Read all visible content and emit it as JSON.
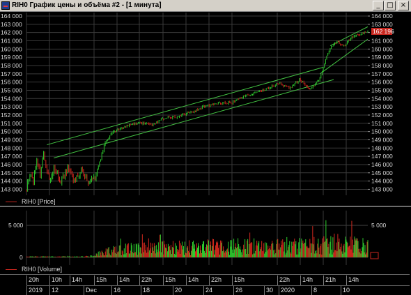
{
  "window": {
    "title": "RIH0 График цены и объёма #2 - [1 минута]",
    "buttons": {
      "minimize": "_",
      "maximize": "□",
      "close": "×"
    }
  },
  "price_panel": {
    "legend": "RIH0 [Price]",
    "y_ticks": [
      "164 000",
      "163 000",
      "162 000",
      "161 000",
      "160 000",
      "159 000",
      "158 000",
      "157 000",
      "156 000",
      "155 000",
      "154 000",
      "153 000",
      "152 000",
      "151 000",
      "150 000",
      "149 000",
      "148 000",
      "147 000",
      "146 000",
      "145 000",
      "144 000",
      "143 000"
    ],
    "last_price_label": "162 196",
    "colors": {
      "up": "#2ecc2e",
      "down": "#d2281e",
      "channel": "#43c243",
      "last_price_box": "#c8261e"
    }
  },
  "volume_panel": {
    "legend": "RIH0 [Volume]",
    "y_ticks": [
      "5 000",
      "0"
    ],
    "colors": {
      "up": "#2ecc2e",
      "down": "#d2281e"
    }
  },
  "time_axis": {
    "hours": [
      "20h",
      "10h",
      "14h",
      "15h",
      "14h",
      "22h",
      "15h",
      "14h",
      "22h",
      "15h",
      "22h",
      "14h",
      "21h",
      "14h"
    ],
    "dates": [
      "2019",
      "12",
      "Dec",
      "16",
      "18",
      "20",
      "24",
      "26",
      "30",
      "2020",
      "8",
      "10"
    ]
  },
  "chart_data": [
    {
      "type": "candlestick",
      "title": "RIH0 График цены и объёма #2 - [1 минута]",
      "series": [
        {
          "name": "RIH0 [Price]"
        }
      ],
      "ylim": [
        142700,
        164000
      ],
      "y_ticks": [
        164000,
        163000,
        162000,
        161000,
        160000,
        159000,
        158000,
        157000,
        156000,
        155000,
        154000,
        153000,
        152000,
        151000,
        150000,
        149000,
        148000,
        147000,
        146000,
        145000,
        144000,
        143000
      ],
      "x_tick_labels": [
        "20h",
        "10h",
        "14h",
        "15h",
        "14h",
        "22h",
        "15h",
        "14h",
        "22h",
        "15h",
        "22h",
        "14h",
        "21h",
        "14h"
      ],
      "x_date_labels": [
        "2019",
        "12",
        "Dec",
        "16",
        "18",
        "20",
        "24",
        "26",
        "30",
        "2020",
        "8",
        "10"
      ],
      "price_path": [
        [
          0,
          142900
        ],
        [
          0.01,
          144800
        ],
        [
          0.02,
          143600
        ],
        [
          0.03,
          146800
        ],
        [
          0.04,
          144500
        ],
        [
          0.05,
          147300
        ],
        [
          0.06,
          145200
        ],
        [
          0.07,
          144000
        ],
        [
          0.08,
          145800
        ],
        [
          0.1,
          143800
        ],
        [
          0.12,
          145600
        ],
        [
          0.14,
          144200
        ],
        [
          0.16,
          145300
        ],
        [
          0.18,
          143700
        ],
        [
          0.2,
          144300
        ],
        [
          0.215,
          146400
        ],
        [
          0.23,
          148600
        ],
        [
          0.25,
          149900
        ],
        [
          0.28,
          150500
        ],
        [
          0.31,
          150900
        ],
        [
          0.34,
          151000
        ],
        [
          0.37,
          150800
        ],
        [
          0.4,
          151600
        ],
        [
          0.44,
          151800
        ],
        [
          0.48,
          152300
        ],
        [
          0.52,
          153000
        ],
        [
          0.56,
          153400
        ],
        [
          0.6,
          153500
        ],
        [
          0.64,
          154300
        ],
        [
          0.68,
          154800
        ],
        [
          0.71,
          155300
        ],
        [
          0.74,
          155900
        ],
        [
          0.77,
          155200
        ],
        [
          0.8,
          156300
        ],
        [
          0.83,
          155100
        ],
        [
          0.86,
          156400
        ],
        [
          0.87,
          157800
        ],
        [
          0.88,
          159200
        ],
        [
          0.89,
          160200
        ],
        [
          0.91,
          160900
        ],
        [
          0.93,
          160400
        ],
        [
          0.95,
          161300
        ],
        [
          0.97,
          161700
        ],
        [
          1.0,
          162196
        ]
      ],
      "channels": [
        {
          "name": "upper-1",
          "from": [
            0.06,
            148400
          ],
          "to": [
            0.87,
            157800
          ]
        },
        {
          "name": "lower-1",
          "from": [
            0.08,
            146800
          ],
          "to": [
            0.9,
            156300
          ]
        },
        {
          "name": "upper-2",
          "from": [
            0.89,
            160400
          ],
          "to": [
            1.0,
            162700
          ]
        },
        {
          "name": "lower-2",
          "from": [
            0.86,
            157000
          ],
          "to": [
            1.0,
            161200
          ]
        }
      ],
      "last_price": 162196
    },
    {
      "type": "bar",
      "title": "RIH0 [Volume]",
      "series": [
        {
          "name": "RIH0 [Volume]"
        }
      ],
      "ylim": [
        0,
        6000
      ],
      "y_ticks": [
        5000,
        0
      ],
      "profile": [
        [
          0,
          150
        ],
        [
          0.15,
          150
        ],
        [
          0.2,
          300
        ],
        [
          0.22,
          1200
        ],
        [
          0.3,
          1800
        ],
        [
          0.4,
          2000
        ],
        [
          0.5,
          2200
        ],
        [
          0.6,
          2400
        ],
        [
          0.7,
          2600
        ],
        [
          0.8,
          2800
        ],
        [
          0.85,
          2700
        ],
        [
          0.9,
          3000
        ],
        [
          1.0,
          2600
        ]
      ]
    }
  ]
}
